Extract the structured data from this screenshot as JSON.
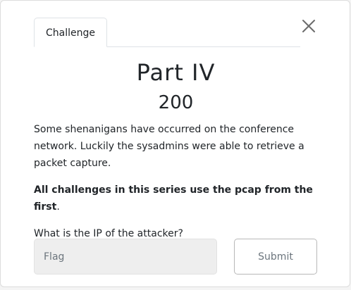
{
  "tabs": [
    {
      "label": "Challenge",
      "active": true
    }
  ],
  "close": {
    "icon": "close-icon"
  },
  "challenge": {
    "name": "Part IV",
    "value": "200",
    "description_paragraph_1": "Some shenanigans have occurred on the conference network. Luckily the sysadmins were able to retrieve a packet capture.",
    "description_bold": "All challenges in this series use the pcap from the first",
    "description_bold_suffix": ".",
    "question": "What is the IP of the attacker?"
  },
  "form": {
    "flag_placeholder": "Flag",
    "flag_value": "",
    "submit_label": "Submit"
  }
}
